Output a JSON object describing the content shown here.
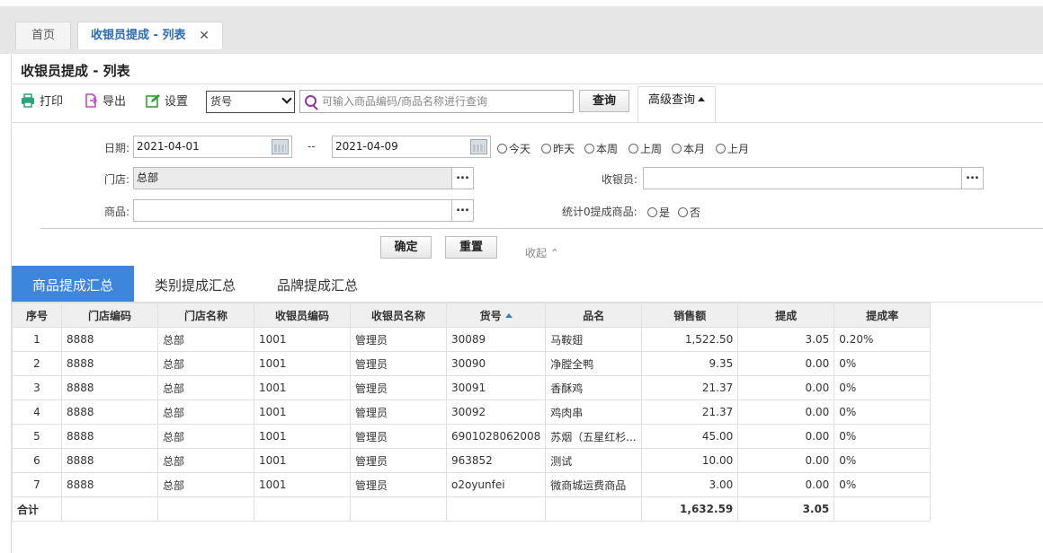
{
  "tabs": {
    "home": "首页",
    "active": "收银员提成 - 列表",
    "close": "✕"
  },
  "page_title": "收银员提成 - 列表",
  "toolbar": {
    "print": "打印",
    "export": "导出",
    "settings": "设置",
    "field_select": "货号",
    "search_placeholder": "可输入商品编码/商品名称进行查询",
    "query": "查询",
    "advanced": "高级查询"
  },
  "filter": {
    "date_label": "日期:",
    "date_from": "2021-04-01",
    "date_sep": "--",
    "date_to": "2021-04-09",
    "quick_dates": [
      "今天",
      "昨天",
      "本周",
      "上周",
      "本月",
      "上月"
    ],
    "store_label": "门店:",
    "store_value": "总部",
    "cashier_label": "收银员:",
    "cashier_value": "",
    "product_label": "商品:",
    "product_value": "",
    "zero_label": "统计0提成商品:",
    "zero_yes": "是",
    "zero_no": "否",
    "confirm": "确定",
    "reset": "重置",
    "collapse": "收起"
  },
  "subtabs": [
    "商品提成汇总",
    "类别提成汇总",
    "品牌提成汇总"
  ],
  "table": {
    "headers": [
      "序号",
      "门店编码",
      "门店名称",
      "收银员编码",
      "收银员名称",
      "货号",
      "品名",
      "销售额",
      "提成",
      "提成率"
    ],
    "rows": [
      [
        "1",
        "8888",
        "总部",
        "1001",
        "管理员",
        "30089",
        "马鞍翅",
        "1,522.50",
        "3.05",
        "0.20%"
      ],
      [
        "2",
        "8888",
        "总部",
        "1001",
        "管理员",
        "30090",
        "净膛全鸭",
        "9.35",
        "0.00",
        "0%"
      ],
      [
        "3",
        "8888",
        "总部",
        "1001",
        "管理员",
        "30091",
        "香酥鸡",
        "21.37",
        "0.00",
        "0%"
      ],
      [
        "4",
        "8888",
        "总部",
        "1001",
        "管理员",
        "30092",
        "鸡肉串",
        "21.37",
        "0.00",
        "0%"
      ],
      [
        "5",
        "8888",
        "总部",
        "1001",
        "管理员",
        "6901028062008",
        "苏烟（五星红杉...",
        "45.00",
        "0.00",
        "0%"
      ],
      [
        "6",
        "8888",
        "总部",
        "1001",
        "管理员",
        "963852",
        "测试",
        "10.00",
        "0.00",
        "0%"
      ],
      [
        "7",
        "8888",
        "总部",
        "1001",
        "管理员",
        "o2oyunfei",
        "微商城运费商品",
        "3.00",
        "0.00",
        "0%"
      ]
    ],
    "total": [
      "合计",
      "",
      "",
      "",
      "",
      "",
      "",
      "1,632.59",
      "3.05",
      ""
    ]
  },
  "colors": {
    "accent": "#3d86dd",
    "tab_active_text": "#2b6cb6"
  },
  "icons": {
    "print": "printer-icon",
    "export": "export-icon",
    "settings": "edit-icon"
  }
}
